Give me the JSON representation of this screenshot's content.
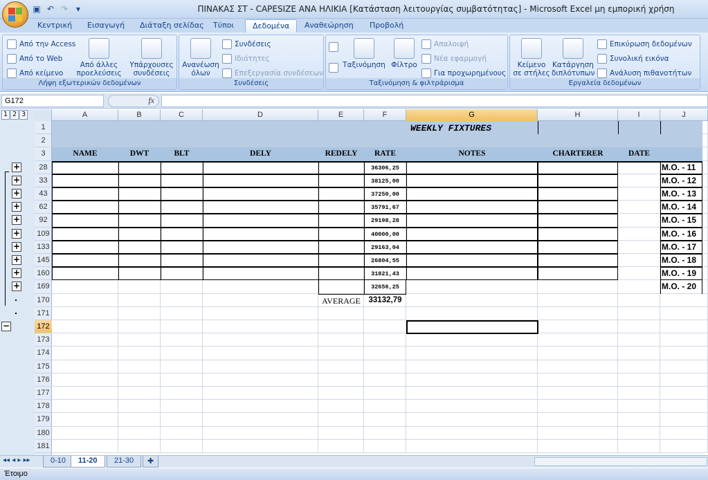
{
  "window": {
    "title": "ΠΙΝΑΚΑΣ ΣΤ - CAPESIZE ΑΝΑ ΗΛΙΚΙΑ  [Κατάσταση λειτουργίας συμβατότητας] - Microsoft Excel μη εμπορική χρήση"
  },
  "tabs": [
    "Κεντρική",
    "Εισαγωγή",
    "Διάταξη σελίδας",
    "Τύποι",
    "Δεδομένα",
    "Αναθεώρηση",
    "Προβολή"
  ],
  "ribbon": {
    "ext": {
      "access": "Από την Access",
      "web": "Από το Web",
      "text": "Από κείμενο",
      "other": "Από άλλες προελεύσεις",
      "existing": "Υπάρχουσες συνδέσεις",
      "label": "Λήψη εξωτερικών δεδομένων"
    },
    "conn": {
      "refresh": "Ανανέωση όλων",
      "connections": "Συνδέσεις",
      "properties": "Ιδιότητες",
      "edit": "Επεξεργασία συνδέσεων",
      "label": "Συνδέσεις"
    },
    "sort": {
      "sort": "Ταξινόμηση",
      "filter": "Φίλτρο",
      "clear": "Απαλοιφή",
      "reapply": "Νέα εφαρμογή",
      "advanced": "Για προχωρημένους",
      "label": "Ταξινόμηση & φιλτράρισμα"
    },
    "tools": {
      "text_to_cols": "Κείμενο σε στήλες",
      "remove_dup": "Κατάργηση διπλότυπων",
      "validation": "Επικύρωση δεδομένων",
      "consolidate": "Συνολική εικόνα",
      "whatif": "Ανάλυση πιθανοτήτων",
      "label": "Εργαλεία δεδομένων"
    }
  },
  "formula": {
    "namebox": "G172",
    "fx": "fx",
    "content": ""
  },
  "outline_levels": [
    "1",
    "2",
    "3"
  ],
  "columns": [
    "A",
    "B",
    "C",
    "D",
    "E",
    "F",
    "G",
    "H",
    "I",
    "J"
  ],
  "sheet": {
    "title": "WEEKLY FIXTURES",
    "headers": {
      "name": "NAME",
      "dwt": "DWT",
      "blt": "BLT",
      "dely": "DELY",
      "redely": "REDELY",
      "rate": "RATE",
      "notes": "NOTES",
      "charterer": "CHARTERER",
      "date": "DATE"
    },
    "rows": [
      {
        "row": "28",
        "rate": "36306,25",
        "mo": "M.O. - 11"
      },
      {
        "row": "33",
        "rate": "38125,00",
        "mo": "M.O. - 12"
      },
      {
        "row": "43",
        "rate": "37250,00",
        "mo": "M.O. - 13"
      },
      {
        "row": "62",
        "rate": "35791,67",
        "mo": "M.O. - 14"
      },
      {
        "row": "92",
        "rate": "29198,28",
        "mo": "M.O. - 15"
      },
      {
        "row": "109",
        "rate": "40000,00",
        "mo": "M.O. - 16"
      },
      {
        "row": "133",
        "rate": "29163,04",
        "mo": "M.O. - 17"
      },
      {
        "row": "145",
        "rate": "26804,55",
        "mo": "M.O. - 18"
      },
      {
        "row": "160",
        "rate": "31821,43",
        "mo": "M.O. - 19"
      },
      {
        "row": "169",
        "rate": "32656,25",
        "mo": "M.O. - 20"
      }
    ],
    "average_label": "AVERAGE",
    "average_value": "33132,79",
    "extra_rows": [
      "170",
      "171",
      "172",
      "173",
      "174",
      "175",
      "176",
      "177",
      "178",
      "179",
      "180",
      "181"
    ],
    "top_rows": [
      "1",
      "2",
      "3"
    ]
  },
  "sheet_tabs": [
    "0-10",
    "11-20",
    "21-30"
  ],
  "status": "Έτοιμο"
}
